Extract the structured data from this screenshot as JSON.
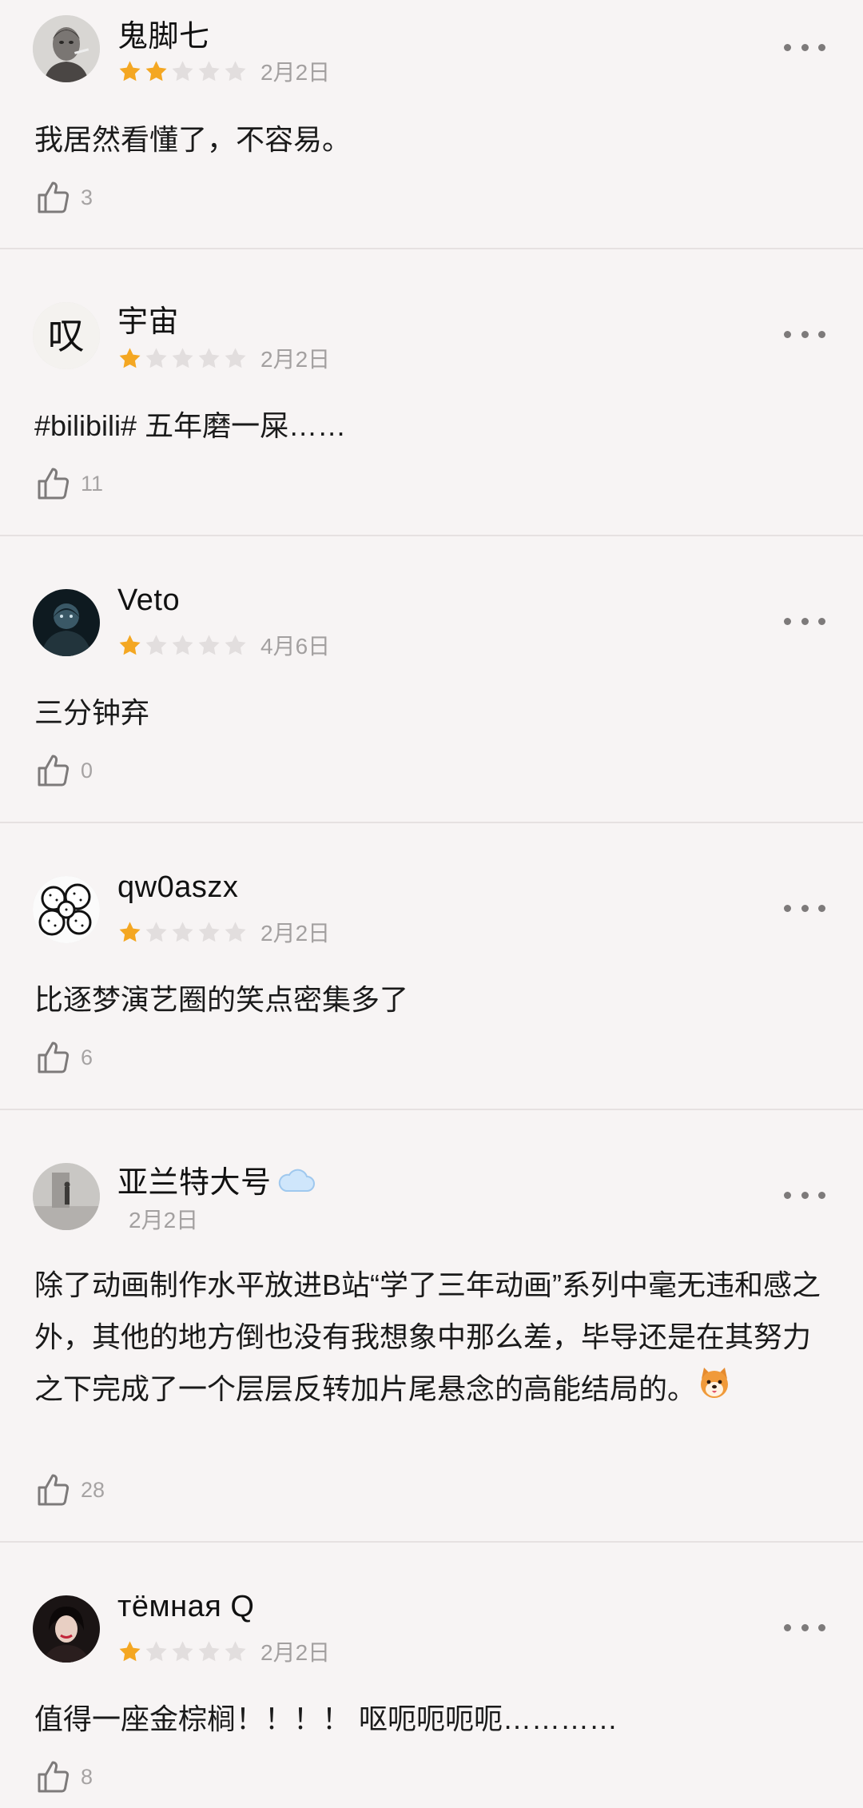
{
  "colors": {
    "background": "#f7f4f4",
    "star_filled": "#f4a722",
    "star_empty": "#e2dede",
    "meta_text": "#a3a0a0",
    "divider": "#e6e1e1"
  },
  "reviews": [
    {
      "username": "鬼脚七",
      "avatar": "man-portrait-avatar",
      "rating": 2,
      "max_rating": 5,
      "date": "2月2日",
      "content": "我居然看懂了，不容易。",
      "likes": "3",
      "more_icon": "more-horizontal-icon",
      "like_icon": "thumbs-up-icon"
    },
    {
      "username": "宇宙",
      "avatar": "calligraphy-avatar",
      "avatar_text": "叹",
      "rating": 1,
      "max_rating": 5,
      "date": "2月2日",
      "content": "#bilibili# 五年磨一屎……",
      "likes": "11",
      "more_icon": "more-horizontal-icon",
      "like_icon": "thumbs-up-icon"
    },
    {
      "username": "Veto",
      "avatar": "dark-figure-avatar",
      "rating": 1,
      "max_rating": 5,
      "date": "4月6日",
      "content": "三分钟弃",
      "likes": "0",
      "more_icon": "more-horizontal-icon",
      "like_icon": "thumbs-up-icon"
    },
    {
      "username": "qw0aszx",
      "avatar": "doodle-avatar",
      "rating": 1,
      "max_rating": 5,
      "date": "2月2日",
      "content": "比逐梦演艺圈的笑点密集多了",
      "likes": "6",
      "more_icon": "more-horizontal-icon",
      "like_icon": "thumbs-up-icon"
    },
    {
      "username": "亚兰特大号",
      "username_icon": "cloud-icon",
      "avatar": "grey-street-avatar",
      "rating": 0,
      "max_rating": 5,
      "date": "2月2日",
      "content": "除了动画制作水平放进B站“学了三年动画”系列中毫无违和感之外，其他的地方倒也没有我想象中那么差，毕导还是在其努力之下完成了一个层层反转加片尾悬念的高能结局的。",
      "content_emoji": "shiba-dog-emoji",
      "likes": "28",
      "more_icon": "more-horizontal-icon",
      "like_icon": "thumbs-up-icon"
    },
    {
      "username": "тёмная Q",
      "avatar": "woman-portrait-avatar",
      "rating": 1,
      "max_rating": 5,
      "date": "2月2日",
      "content": "值得一座金棕榈！！！！ 呕呃呃呃呃…………",
      "likes": "8",
      "more_icon": "more-horizontal-icon",
      "like_icon": "thumbs-up-icon"
    }
  ]
}
